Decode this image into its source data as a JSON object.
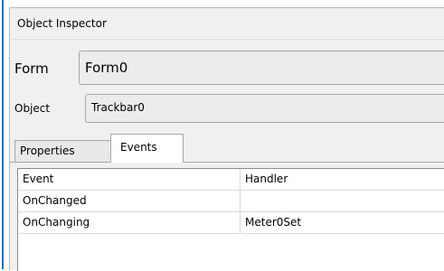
{
  "window": {
    "title": "Object Inspector"
  },
  "form_row": {
    "label": "Form",
    "value": "Form0"
  },
  "object_row": {
    "label": "Object",
    "value": "Trackbar0"
  },
  "tabs": [
    {
      "label": "Properties",
      "active": false
    },
    {
      "label": "Events",
      "active": true
    }
  ],
  "grid": {
    "columns": [
      "Event",
      "Handler"
    ],
    "rows": [
      {
        "event": "OnChanged",
        "handler": ""
      },
      {
        "event": "OnChanging",
        "handler": "Meter0Set"
      }
    ]
  },
  "colors": {
    "accent_border": "#1e6fb8",
    "panel_bg": "#f0f0f0"
  }
}
